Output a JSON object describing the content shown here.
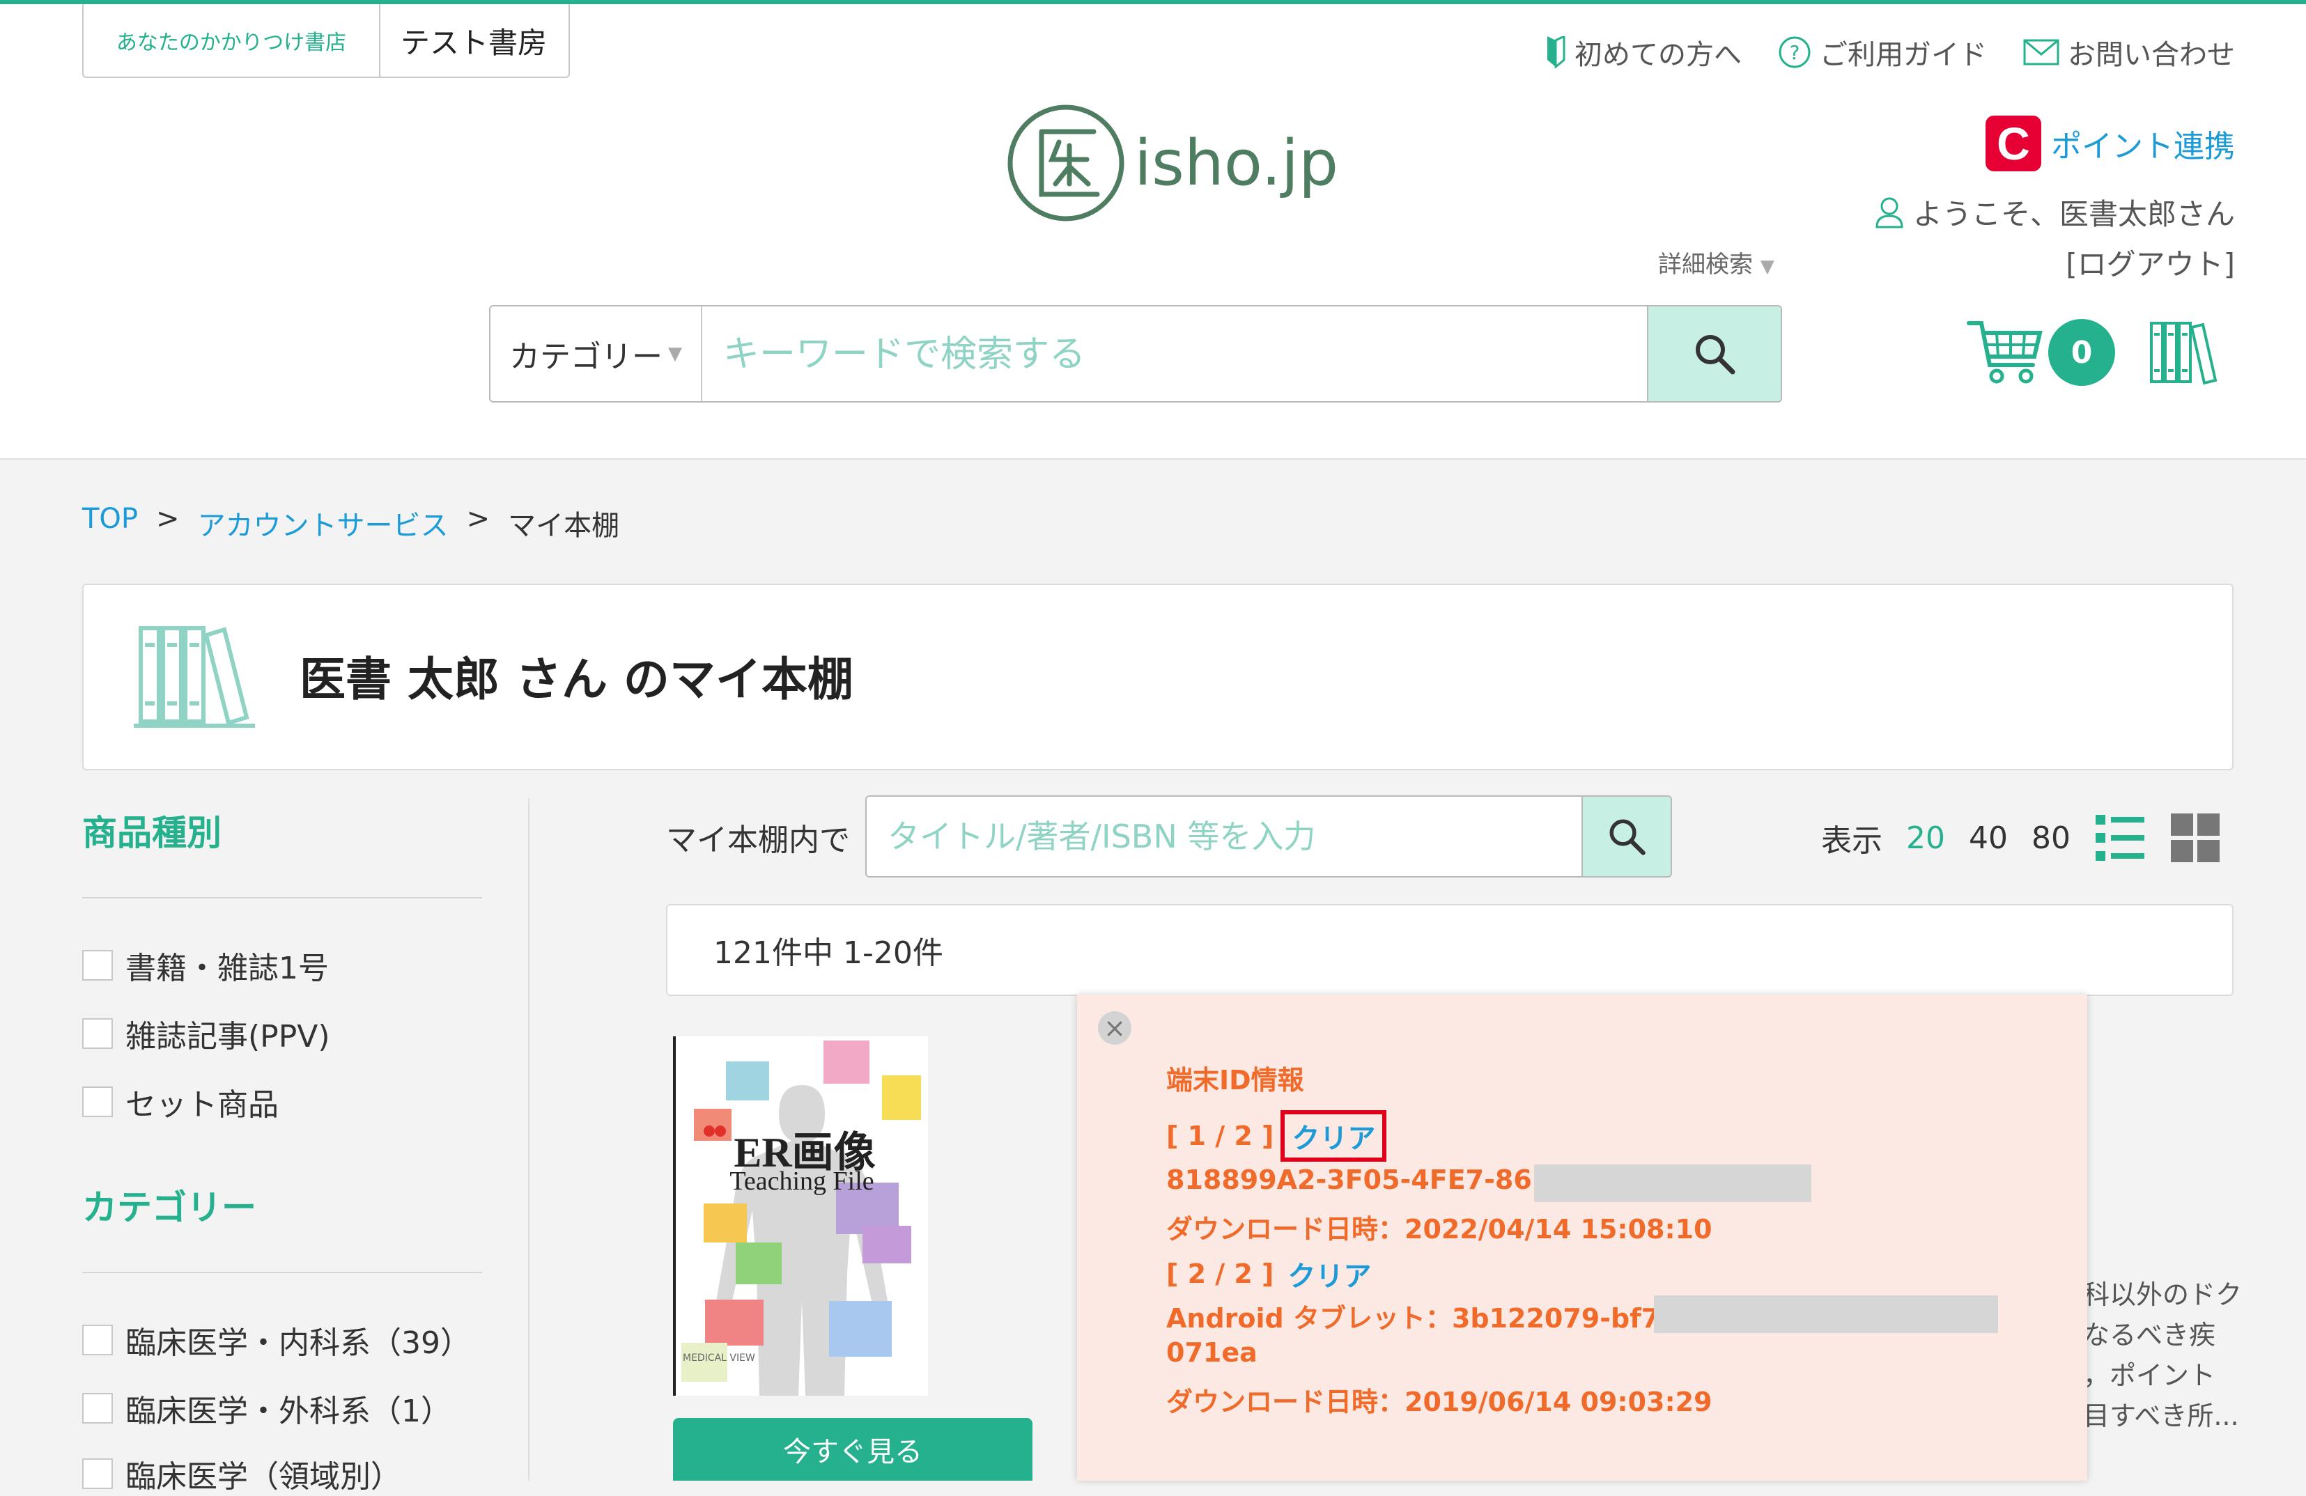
{
  "header": {
    "store_tag": "あなたのかかりつけ書店",
    "store_name": "テスト書房",
    "links": [
      {
        "label": "初めての方へ",
        "icon": "beginner-icon"
      },
      {
        "label": "ご利用ガイド",
        "icon": "help-icon"
      },
      {
        "label": "お問い合わせ",
        "icon": "mail-icon"
      }
    ],
    "point_link": "ポイント連携",
    "point_logo": "C",
    "logo_text": "isho.jp",
    "welcome": "ようこそ、医書太郎さん",
    "logout": "[ログアウト]",
    "detail_search": "詳細検索",
    "category_select": "カテゴリー",
    "search_placeholder": "キーワードで検索する",
    "cart_count": "0"
  },
  "breadcrumb": [
    "TOP",
    ">",
    "アカウントサービス",
    ">",
    "マイ本棚"
  ],
  "page_title": "医書 太郎 さん のマイ本棚",
  "sidebar": {
    "product_type_heading": "商品種別",
    "product_types": [
      "書籍・雑誌1号",
      "雑誌記事(PPV)",
      "セット商品"
    ],
    "category_heading": "カテゴリー",
    "categories": [
      "臨床医学・内科系（39）",
      "臨床医学・外科系（1）",
      "臨床医学（領域別）"
    ]
  },
  "shelf_search": {
    "label": "マイ本棚内で",
    "placeholder": "タイトル/著者/ISBN 等を入力"
  },
  "display": {
    "label": "表示",
    "options": [
      "20",
      "40",
      "80"
    ],
    "selected": "20"
  },
  "result_count": "121件中 1-20件",
  "book": {
    "title_main": "ER画像",
    "title_sub": "Teaching File",
    "publisher": "MEDICAL VIEW",
    "watch_button": "今すぐ見る",
    "description_fragments": [
      "科以外のドク",
      "なるべき疾",
      "，ポイント",
      "目すべき所..."
    ]
  },
  "device_popup": {
    "title": "端末ID情報",
    "entries": [
      {
        "index": "[ 1 / 2 ]",
        "clear": "クリア",
        "id_line": "818899A2-3F05-4FE7-86",
        "id_line2": "",
        "download": "ダウンロード日時：2022/04/14 15:08:10"
      },
      {
        "index": "[ 2 / 2 ]",
        "clear": "クリア",
        "id_line": "Android タブレット：3b122079-bf7",
        "id_line2": "071ea",
        "download": "ダウンロード日時：2019/06/14 09:03:29"
      }
    ]
  },
  "colors": {
    "accent": "#25b08e",
    "link": "#1c9bd6",
    "popup_bg": "#fde9e4",
    "popup_text": "#f06a2a",
    "highlight": "#e0001a"
  }
}
